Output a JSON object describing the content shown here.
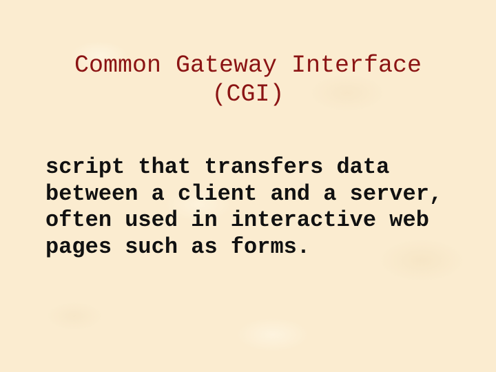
{
  "slide": {
    "title_lines": [
      "Common Gateway Interface",
      "(CGI)"
    ],
    "body_lines": [
      "script that transfers data",
      "between a client and a server,",
      "often used in interactive web",
      "pages such as forms."
    ],
    "colors": {
      "background": "#fbecd0",
      "title": "#8b1414",
      "body": "#111111"
    }
  }
}
